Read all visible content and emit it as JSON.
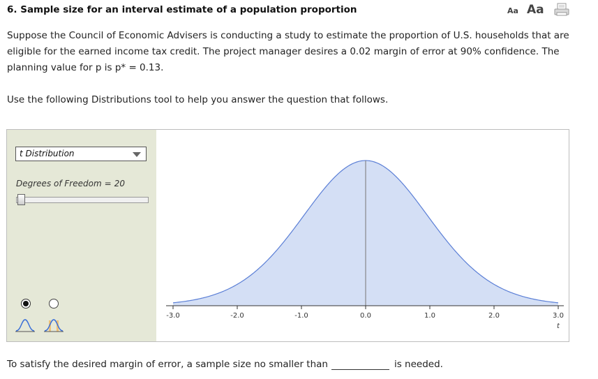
{
  "question": {
    "title": "6. Sample size for an interval estimate of a population proportion",
    "paragraph1": "Suppose the Council of Economic Advisers is conducting a study to estimate the proportion of U.S. households that are eligible for the earned income tax credit. The project manager desires a 0.02 margin of error at 90% confidence. The planning value for p is p* = 0.13.",
    "paragraph2": "Use the following Distributions tool to help you answer the question that follows."
  },
  "text_tools": {
    "small_label": "Aa",
    "large_label": "Aa",
    "print_icon": "print-icon"
  },
  "tool": {
    "distribution_select": "t Distribution",
    "df_label": "Degrees of Freedom",
    "df_eq": "=",
    "df_value": "20",
    "radio_selected": 0,
    "mode_icons": [
      "single-curve-icon",
      "shaded-tails-curve-icon"
    ],
    "colors": {
      "panel_bg": "#e5e8d7",
      "curve_fill": "#d4dff5",
      "curve_stroke": "#5b7fd6",
      "center_line": "#888888"
    }
  },
  "chart_data": {
    "type": "area",
    "distribution": "t",
    "df": 20,
    "xlim": [
      -3.0,
      3.0
    ],
    "ticks": [
      "-3.0",
      "-2.0",
      "-1.0",
      "0.0",
      "1.0",
      "2.0",
      "3.0"
    ],
    "xlabel": "t"
  },
  "answer": {
    "prefix": "To satisfy the desired margin of error, a sample size no smaller than",
    "value": "",
    "suffix": "is needed."
  }
}
